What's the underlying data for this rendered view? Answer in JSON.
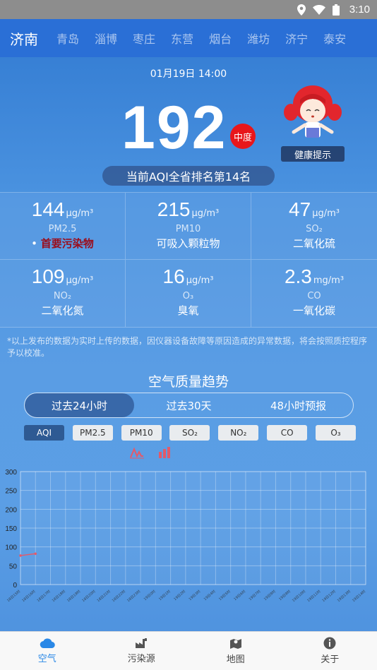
{
  "status_bar": {
    "time": "3:10"
  },
  "cities": [
    "济南",
    "青岛",
    "淄博",
    "枣庄",
    "东营",
    "烟台",
    "潍坊",
    "济宁",
    "泰安"
  ],
  "header": {
    "datetime": "01月19日 14:00",
    "aqi": "192",
    "level": "中度",
    "health_tip_label": "健康提示",
    "rank_text": "当前AQI全省排名第14名"
  },
  "pollutants": [
    {
      "value": "144",
      "unit": "μg/m³",
      "name": "PM2.5",
      "desc": "首要污染物",
      "primary": true
    },
    {
      "value": "215",
      "unit": "μg/m³",
      "name": "PM10",
      "desc": "可吸入颗粒物",
      "primary": false
    },
    {
      "value": "47",
      "unit": "μg/m³",
      "name": "SO₂",
      "desc": "二氧化硫",
      "primary": false
    },
    {
      "value": "109",
      "unit": "μg/m³",
      "name": "NO₂",
      "desc": "二氧化氮",
      "primary": false
    },
    {
      "value": "16",
      "unit": "μg/m³",
      "name": "O₃",
      "desc": "臭氧",
      "primary": false
    },
    {
      "value": "2.3",
      "unit": "mg/m³",
      "name": "CO",
      "desc": "一氧化碳",
      "primary": false
    }
  ],
  "notice": "*以上发布的数据为实时上传的数据，因仪器设备故障等原因造成的异常数据，将会按照质控程序予以校准。",
  "trend": {
    "title": "空气质量趋势",
    "tabs": [
      "过去24小时",
      "过去30天",
      "48小时预报"
    ],
    "metrics": [
      "AQI",
      "PM2.5",
      "PM10",
      "SO₂",
      "NO₂",
      "CO",
      "O₃"
    ]
  },
  "chart_data": {
    "type": "line",
    "title": "",
    "xlabel": "",
    "ylabel": "",
    "ylim": [
      0,
      300
    ],
    "y_ticks": [
      0,
      50,
      100,
      150,
      200,
      250,
      300
    ],
    "x": [
      "18日15时",
      "18日16时",
      "18日17时",
      "18日18时",
      "18日19时",
      "18日20时",
      "18日21时",
      "18日22时",
      "18日23时",
      "19日0时",
      "19日1时",
      "19日2时",
      "19日3时",
      "19日4时",
      "19日5时",
      "19日6时",
      "19日7时",
      "19日8时",
      "19日9时",
      "19日10时",
      "19日11时",
      "19日12时",
      "19日13时",
      "19日14时"
    ],
    "series": [
      {
        "values": [
          77,
          82
        ]
      }
    ],
    "grid": true
  },
  "colors": {
    "accent": "#2a88e6",
    "level_moderate": "#e8161b",
    "line": "#e35a6a"
  },
  "bottom_nav": [
    {
      "label": "空气",
      "icon": "cloud-icon",
      "active": true
    },
    {
      "label": "污染源",
      "icon": "factory-icon",
      "active": false
    },
    {
      "label": "地图",
      "icon": "map-icon",
      "active": false
    },
    {
      "label": "关于",
      "icon": "info-icon",
      "active": false
    }
  ]
}
